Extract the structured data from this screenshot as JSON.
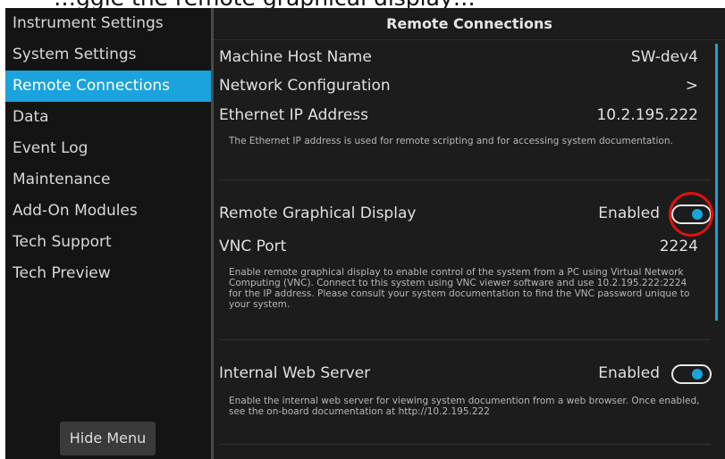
{
  "caption": "…ggle the remote graphical display…",
  "sidebar": {
    "items": [
      {
        "label": "Instrument Settings"
      },
      {
        "label": "System Settings"
      },
      {
        "label": "Remote Connections",
        "active": true
      },
      {
        "label": "Data"
      },
      {
        "label": "Event Log"
      },
      {
        "label": "Maintenance"
      },
      {
        "label": "Add-On Modules"
      },
      {
        "label": "Tech Support"
      },
      {
        "label": "Tech Preview"
      }
    ],
    "hide_menu_label": "Hide Menu"
  },
  "main": {
    "title": "Remote Connections",
    "host": {
      "label": "Machine Host Name",
      "value": "SW-dev4"
    },
    "network": {
      "label": "Network Configuration",
      "value": ">"
    },
    "ethernet": {
      "label": "Ethernet IP Address",
      "value": "10.2.195.222",
      "description": "The Ethernet IP address is used for remote scripting and for accessing system documentation."
    },
    "remote_display": {
      "label": "Remote Graphical Display",
      "status": "Enabled",
      "enabled": true,
      "toggle_icon": "toggle-switch-icon"
    },
    "vnc": {
      "label": "VNC Port",
      "value": "2224",
      "description": "Enable remote graphical display to enable control of the system from a PC using Virtual Network Computing (VNC). Connect to this system using VNC viewer software and use 10.2.195.222:2224 for the IP address.  Please consult your system documentation to find the VNC password unique to your system."
    },
    "web_server": {
      "label": "Internal Web Server",
      "status": "Enabled",
      "enabled": true,
      "description": "Enable the internal web server for viewing system documention from a web browser. Once enabled, see the on-board documentation at http://10.2.195.222"
    }
  },
  "colors": {
    "accent": "#1aa3dc",
    "background": "#1c1c1c",
    "sidebar": "#141414",
    "annotation": "#e01010"
  }
}
